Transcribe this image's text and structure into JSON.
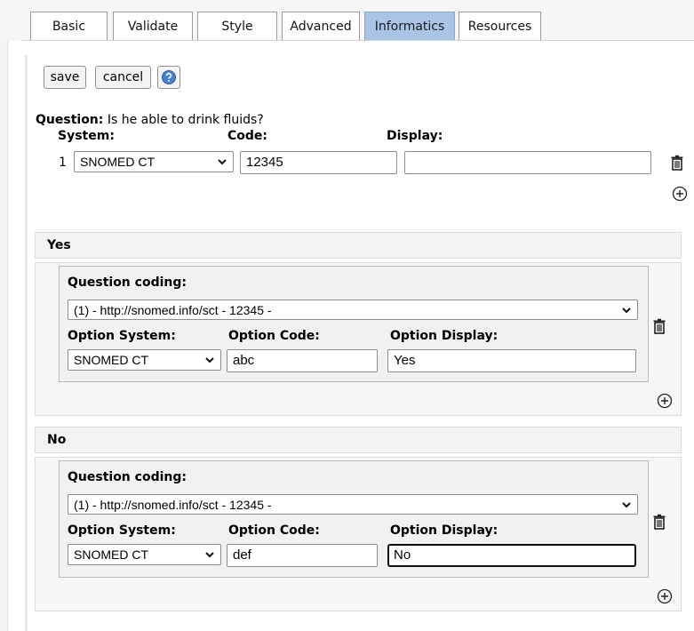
{
  "tabs": [
    {
      "label": "Basic"
    },
    {
      "label": "Validate"
    },
    {
      "label": "Style"
    },
    {
      "label": "Advanced"
    },
    {
      "label": "Informatics",
      "active": true
    },
    {
      "label": "Resources"
    }
  ],
  "toolbar": {
    "save_label": "save",
    "cancel_label": "cancel",
    "help_icon": "help-icon"
  },
  "question": {
    "label": "Question:",
    "text": "Is he able to drink fluids?",
    "system_header": "System:",
    "code_header": "Code:",
    "display_header": "Display:",
    "coding_rows": [
      {
        "index": "1",
        "system": "SNOMED CT",
        "code": "12345",
        "display": ""
      }
    ]
  },
  "answers": [
    {
      "title": "Yes",
      "question_coding_label": "Question coding:",
      "question_coding_value": "(1) - http://snomed.info/sct - 12345 -",
      "option_system_label": "Option System:",
      "option_code_label": "Option Code:",
      "option_display_label": "Option Display:",
      "option_system": "SNOMED CT",
      "option_code": "abc",
      "option_display": "Yes"
    },
    {
      "title": "No",
      "question_coding_label": "Question coding:",
      "question_coding_value": "(1) - http://snomed.info/sct - 12345 -",
      "option_system_label": "Option System:",
      "option_code_label": "Option Code:",
      "option_display_label": "Option Display:",
      "option_system": "SNOMED CT",
      "option_code": "def",
      "option_display": "No"
    }
  ],
  "colors": {
    "active_tab": "#a9c4e4",
    "help_icon": "#4a7fd0"
  }
}
